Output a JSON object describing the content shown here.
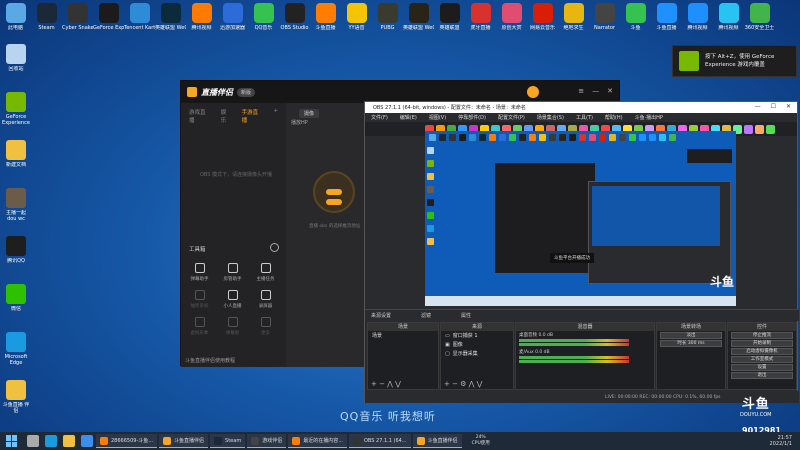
{
  "top_icons": [
    {
      "label": "此电脑",
      "color": "#5aa9e6"
    },
    {
      "label": "Steam",
      "color": "#1b2838"
    },
    {
      "label": "Cyber Snake",
      "color": "#333"
    },
    {
      "label": "GeForce Experience",
      "color": "#1b1b1b"
    },
    {
      "label": "Tencent Kart",
      "color": "#2e8bd6"
    },
    {
      "label": "英雄联盟 WeGame",
      "color": "#0b2a3a"
    },
    {
      "label": "腾讯视频",
      "color": "#ff7a00"
    },
    {
      "label": "迅游加速器",
      "color": "#2d6bd9"
    },
    {
      "label": "QQ音乐",
      "color": "#36c24e"
    },
    {
      "label": "OBS Studio",
      "color": "#222"
    },
    {
      "label": "斗鱼直播",
      "color": "#ff7d00"
    },
    {
      "label": "YY语音",
      "color": "#f5c400"
    },
    {
      "label": "PUBG",
      "color": "#3a3a2e"
    },
    {
      "label": "英雄联盟 WeGame",
      "color": "#2a2418"
    },
    {
      "label": "英雄联盟",
      "color": "#1c1c1c"
    },
    {
      "label": "虎牙直播",
      "color": "#d9322e"
    },
    {
      "label": "原创大赏",
      "color": "#e14c70"
    },
    {
      "label": "网易云音乐",
      "color": "#d81e06"
    },
    {
      "label": "绝地求生",
      "color": "#e8b70f"
    },
    {
      "label": "Narrator",
      "color": "#444"
    },
    {
      "label": "斗鱼",
      "color": "#36c24e"
    },
    {
      "label": "斗鱼直播",
      "color": "#1e90ff"
    },
    {
      "label": "腾讯视频",
      "color": "#1e8fff"
    },
    {
      "label": "腾讯视频",
      "color": "#28c3f0"
    },
    {
      "label": "360安全卫士",
      "color": "#41b44a"
    }
  ],
  "desktop_icons": [
    {
      "label": "回收站",
      "color": "#b8d4ee"
    },
    {
      "label": "GeForce Experience",
      "color": "#76b900"
    },
    {
      "label": "新建文档",
      "color": "#f0c040"
    },
    {
      "label": "主播一起 dou wc",
      "color": "#6b5b4b"
    },
    {
      "label": "腾讯QQ",
      "color": "#1e1e1e"
    },
    {
      "label": "微信",
      "color": "#2dc100"
    },
    {
      "label": "Microsoft Edge",
      "color": "#1a9ae0"
    },
    {
      "label": "斗鱼直播 伴侣",
      "color": "#f0c040"
    }
  ],
  "nvidia_toast": {
    "line1": "按下 Alt+Z，使用 GeForce",
    "line2": "Experience 游戏内覆盖"
  },
  "app": {
    "name": "直播伴侣",
    "version": "新版",
    "tabs": [
      "游戏直播",
      "娱乐",
      "手游直播"
    ],
    "active_tab_index": 2,
    "scene_empty": "OBS 模式下，请连接摄像头开播",
    "tools_title": "工具箱",
    "tools": [
      {
        "label": "弹幕助手",
        "dim": false
      },
      {
        "label": "房管助手",
        "dim": false
      },
      {
        "label": "主播任务",
        "dim": false
      },
      {
        "label": "抽奖系统",
        "dim": true
      },
      {
        "label": "小人直播",
        "dim": false
      },
      {
        "label": "录屏器",
        "dim": false
      },
      {
        "label": "虚拟形象",
        "dim": true
      },
      {
        "label": "弹幕姬",
        "dim": true
      },
      {
        "label": "更多",
        "dim": true
      }
    ],
    "footer": "斗鱼直播伴侣使用教程",
    "camera_tab": "摄像",
    "camera_row": "播放HP",
    "hint": "直播 obs 的选择推流地址"
  },
  "obs": {
    "title": "OBS 27.1.1 (64-bit, windows) - 配置文件：未命名 - 场景：未命名",
    "menu": [
      "文件(F)",
      "编辑(E)",
      "视图(V)",
      "停靠部件(D)",
      "配置文件(P)",
      "场景集合(S)",
      "工具(T)",
      "帮助(H)",
      "斗鱼·播出HP"
    ],
    "preview_toast": "斗鱼平台开播成功",
    "section_bar": [
      "来源设置",
      "滤镜",
      "属性"
    ],
    "panels": {
      "scenes": {
        "title": "场景",
        "items": [
          "场景"
        ]
      },
      "sources": {
        "title": "来源",
        "items": [
          "窗口捕获 1",
          "图像",
          "显示器采集"
        ]
      },
      "mixer": {
        "title": "混音器",
        "rows": [
          {
            "label": "桌面音频",
            "db": "0.0 dB"
          },
          {
            "label": "麦/Aux",
            "db": "0.0 dB"
          }
        ]
      },
      "transitions": {
        "title": "场景转场",
        "items": [
          "淡出",
          "时长 300 ms"
        ]
      },
      "controls": {
        "title": "控件",
        "buttons": [
          "停止推流",
          "开始录制",
          "启动虚拟摄像机",
          "工作室模式",
          "设置",
          "退出"
        ]
      }
    },
    "status": "LIVE: 00:00:00   REC: 00:00:00   CPU: 0.1%, 60.00 fps"
  },
  "lyrics": "QQ音乐 听我想听",
  "douyu": {
    "logo": "斗鱼",
    "url": "DOUYU.COM",
    "room": "9012981"
  },
  "taskbar": {
    "tasks": [
      {
        "label": "28666509-斗鱼...",
        "color": "#ff7d00"
      },
      {
        "label": "斗鱼直播伴侣",
        "color": "#f6a623"
      },
      {
        "label": "Steam",
        "color": "#1b2838"
      },
      {
        "label": "游戏伴侣",
        "color": "#444"
      },
      {
        "label": "最近的在播内容...",
        "color": "#ff7d00"
      },
      {
        "label": "OBS 27.1.1 (64...",
        "color": "#333"
      },
      {
        "label": "斗鱼直播伴侣",
        "color": "#f6a623"
      }
    ],
    "cpu": {
      "pct": "24%",
      "label": "CPU使用"
    },
    "time": "21:57",
    "date": "2022/1/1"
  }
}
